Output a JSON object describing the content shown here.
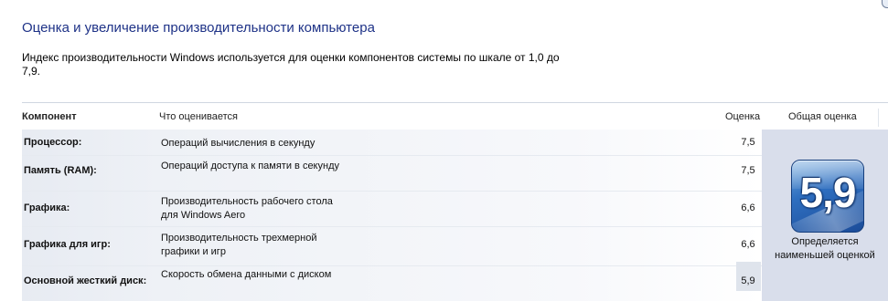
{
  "page": {
    "title": "Оценка и увеличение производительности компьютера",
    "description": "Индекс производительности Windows используется для оценки компонентов системы по шкале от 1,0 до 7,9."
  },
  "table": {
    "headers": {
      "component": "Компонент",
      "what": "Что оценивается",
      "score": "Оценка",
      "base": "Общая оценка"
    },
    "rows": [
      {
        "component": "Процессор:",
        "what": "Операций вычисления в секунду",
        "score": "7,5"
      },
      {
        "component": "Память (RAM):",
        "what": "Операций доступа к памяти в секунду",
        "score": "7,5"
      },
      {
        "component": "Графика:",
        "what": "Производительность рабочего стола для Windows Aero",
        "score": "6,6"
      },
      {
        "component": "Графика для игр:",
        "what": "Производительность трехмерной графики и игр",
        "score": "6,6"
      },
      {
        "component": "Основной жесткий диск:",
        "what": "Скорость обмена данными с диском",
        "score": "5,9"
      }
    ]
  },
  "base_score": {
    "value": "5,9",
    "caption": "Определяется наименьшей оценкой"
  },
  "colors": {
    "title": "#1e3287",
    "badge": "#2f6fc0",
    "panel": "#d9deeb"
  }
}
